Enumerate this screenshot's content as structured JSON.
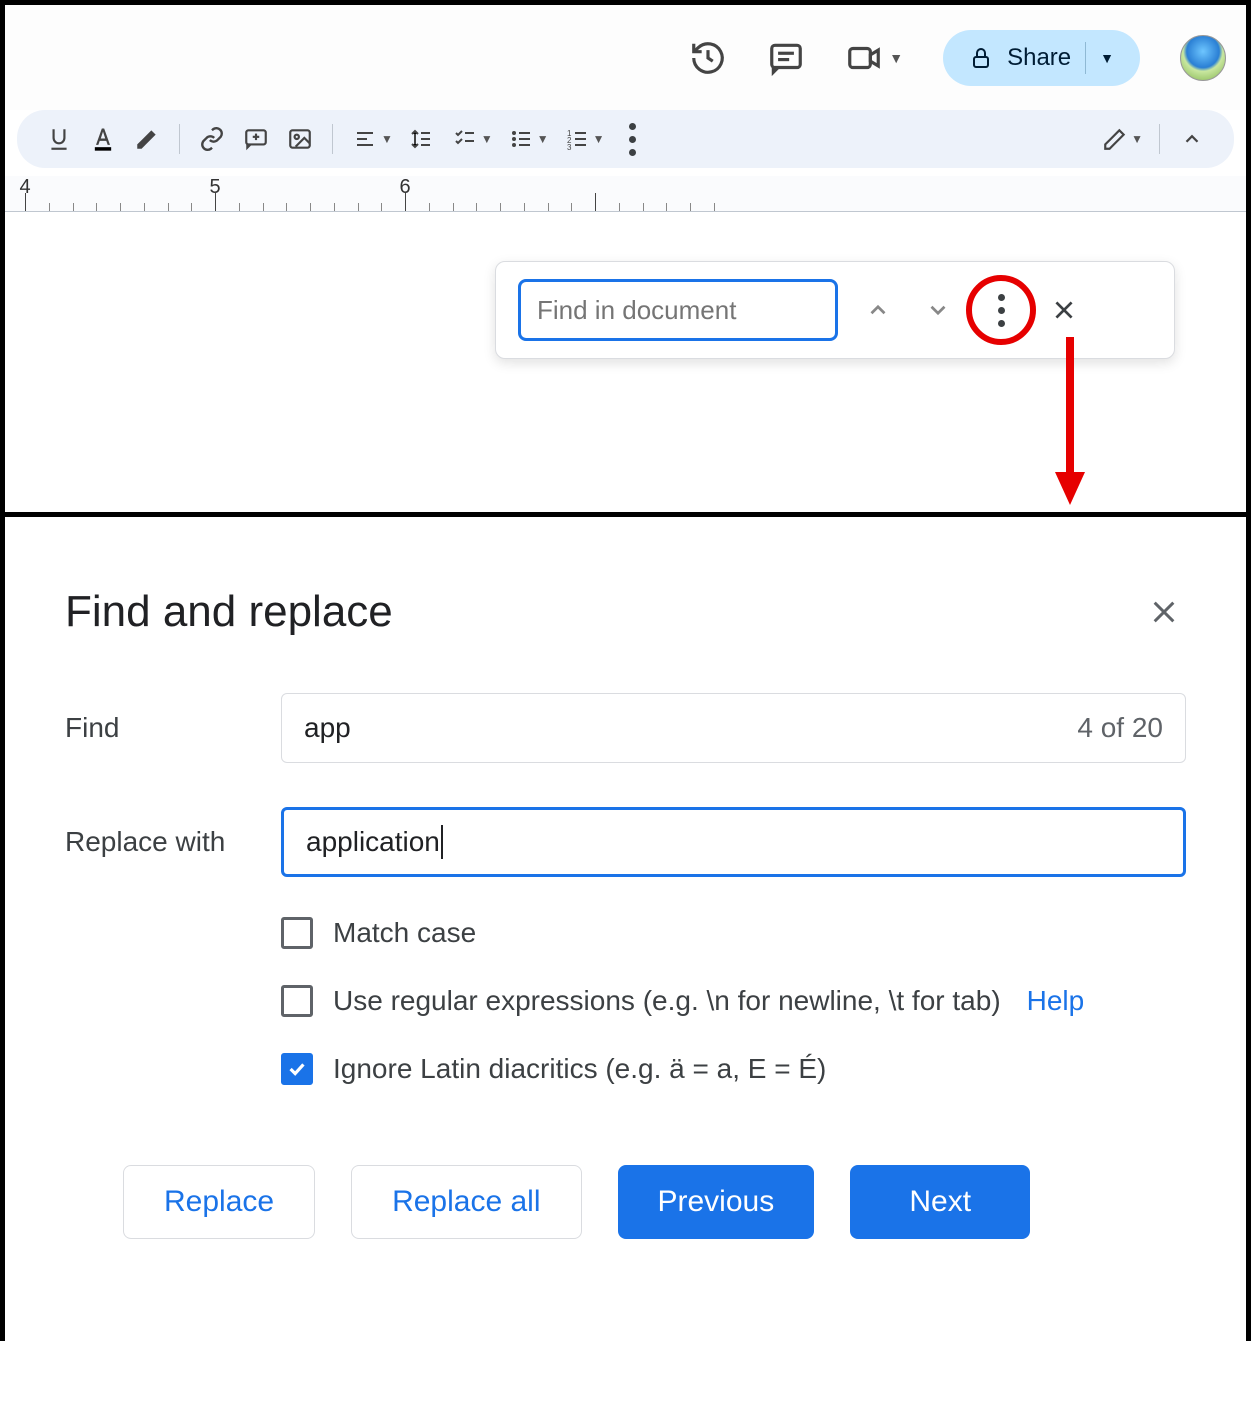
{
  "header": {
    "share_label": "Share"
  },
  "find_bar": {
    "placeholder": "Find in document"
  },
  "ruler": {
    "marks": [
      4,
      5,
      6
    ]
  },
  "dialog": {
    "title": "Find and replace",
    "find_label": "Find",
    "find_value": "app",
    "find_count": "4 of 20",
    "replace_label": "Replace with",
    "replace_value": "application",
    "options": {
      "match_case_label": "Match case",
      "match_case_checked": false,
      "regex_label": "Use regular expressions (e.g. \\n for newline, \\t for tab)",
      "regex_checked": false,
      "regex_help": "Help",
      "diacritics_label": "Ignore Latin diacritics (e.g. ä = a, E = É)",
      "diacritics_checked": true
    },
    "buttons": {
      "replace": "Replace",
      "replace_all": "Replace all",
      "previous": "Previous",
      "next": "Next"
    }
  }
}
